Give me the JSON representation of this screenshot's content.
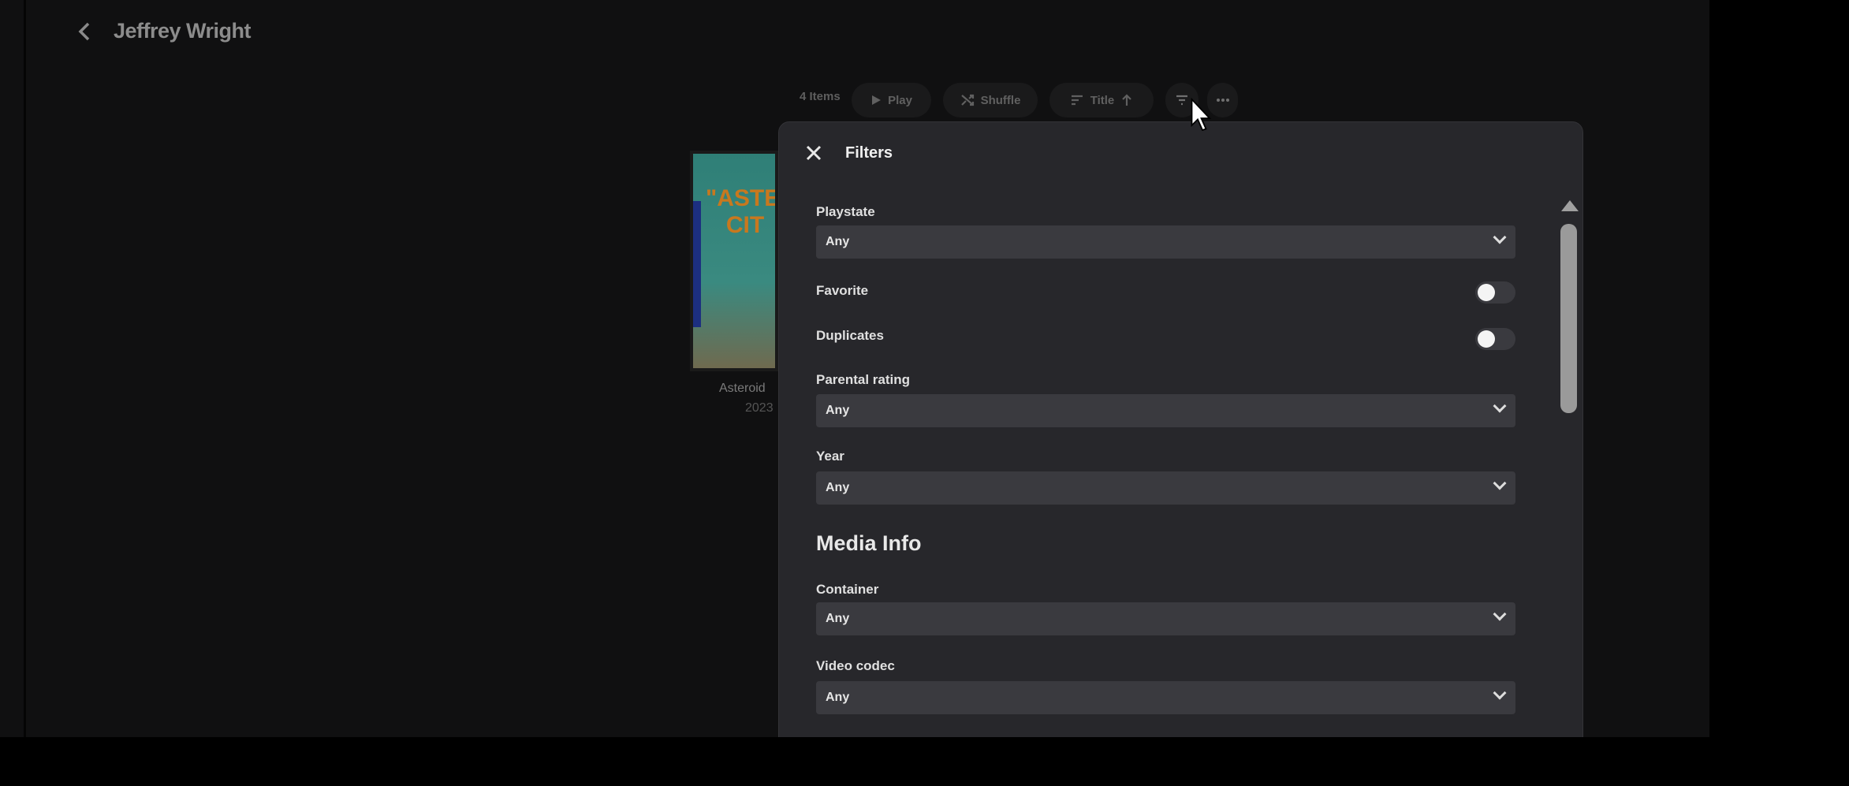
{
  "header": {
    "title": "Jeffrey Wright"
  },
  "toolbar": {
    "count": "4 Items",
    "play": "Play",
    "shuffle": "Shuffle",
    "sort": "Title"
  },
  "items": [
    {
      "title": "Asteroid",
      "year": "2023",
      "poster_text": "ASTER CIT"
    }
  ],
  "filters": {
    "title": "Filters",
    "playstate": {
      "label": "Playstate",
      "value": "Any"
    },
    "favorite": {
      "label": "Favorite",
      "on": false
    },
    "duplicates": {
      "label": "Duplicates",
      "on": false
    },
    "parental": {
      "label": "Parental rating",
      "value": "Any"
    },
    "year": {
      "label": "Year",
      "value": "Any"
    },
    "media_heading": "Media Info",
    "container": {
      "label": "Container",
      "value": "Any"
    },
    "video_codec": {
      "label": "Video codec",
      "value": "Any"
    }
  },
  "colors": {
    "background": "#101011",
    "panel": "#27272b",
    "select": "#3a3a3f"
  }
}
